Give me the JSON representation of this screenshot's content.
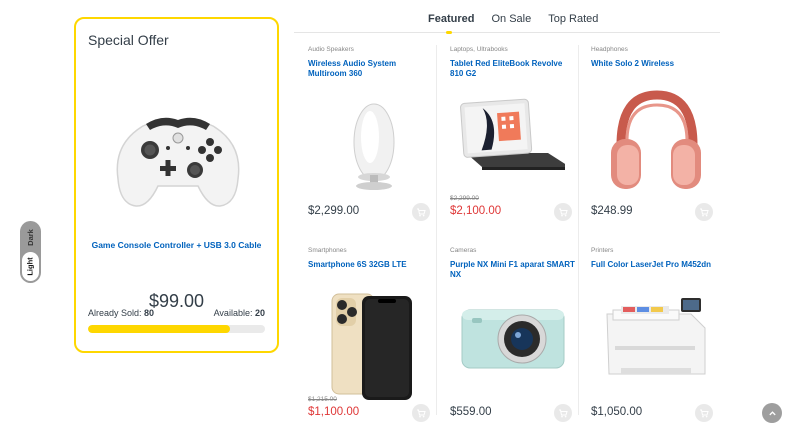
{
  "offer": {
    "title": "Special Offer",
    "product_name": "Game Console Controller + USB 3.0 Cable",
    "price": "$99.00",
    "sold_label": "Already Sold:",
    "sold_value": "80",
    "available_label": "Available:",
    "available_value": "20",
    "sold_fraction": 0.8
  },
  "theme": {
    "dark_label": "Dark",
    "light_label": "Light",
    "selected": "Light"
  },
  "tabs": [
    {
      "label": "Featured",
      "active": true
    },
    {
      "label": "On Sale",
      "active": false
    },
    {
      "label": "Top Rated",
      "active": false
    }
  ],
  "products": [
    {
      "category": "Audio Speakers",
      "name": "Wireless Audio System Multiroom 360",
      "old_price": "",
      "price": "$2,299.00",
      "on_sale": false,
      "image": "speaker"
    },
    {
      "category": "Laptops, Ultrabooks",
      "name": "Tablet Red EliteBook Revolve 810 G2",
      "old_price": "$2,299.00",
      "price": "$2,100.00",
      "on_sale": true,
      "image": "tablet"
    },
    {
      "category": "Headphones",
      "name": "White Solo 2 Wireless",
      "old_price": "",
      "price": "$248.99",
      "on_sale": false,
      "image": "headphones"
    },
    {
      "category": "Smartphones",
      "name": "Smartphone 6S 32GB LTE",
      "old_price": "$1,215.00",
      "price": "$1,100.00",
      "on_sale": true,
      "image": "phone"
    },
    {
      "category": "Cameras",
      "name": "Purple NX Mini F1 aparat SMART NX",
      "old_price": "",
      "price": "$559.00",
      "on_sale": false,
      "image": "camera"
    },
    {
      "category": "Printers",
      "name": "Full Color LaserJet Pro M452dn",
      "old_price": "",
      "price": "$1,050.00",
      "on_sale": false,
      "image": "printer"
    }
  ],
  "icons": {
    "cart": "cart-icon",
    "scroll_top": "chevron-up-icon"
  },
  "colors": {
    "accent": "#fed700",
    "link": "#0062bd",
    "sale": "#df3737"
  }
}
